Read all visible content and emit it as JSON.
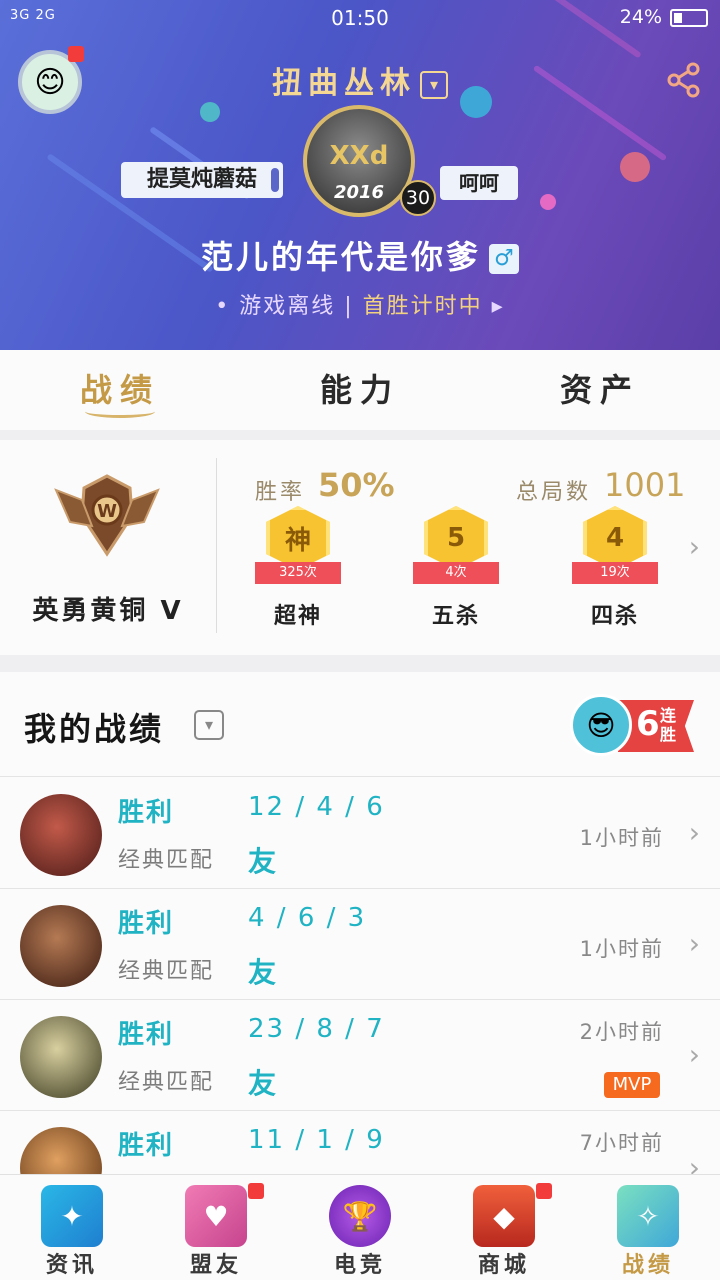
{
  "status_bar": {
    "signal": "3G 2G",
    "time": "01:50",
    "battery": "24%"
  },
  "header": {
    "server": "扭曲丛林",
    "left_tag": "提莫炖蘑菇",
    "right_tag": "呵呵",
    "avatar_logo": "XXd",
    "avatar_year": "2016",
    "level": "30",
    "nickname": "范儿的年代是你爹",
    "gender": "♂",
    "game_status": "游戏离线",
    "first_win": "首胜计时中"
  },
  "tabs": [
    {
      "label": "战绩",
      "active": true
    },
    {
      "label": "能力",
      "active": false
    },
    {
      "label": "资产",
      "active": false
    }
  ],
  "summary": {
    "rank": "英勇黄铜 V",
    "winrate_label": "胜率",
    "winrate": "50%",
    "total_label": "总局数",
    "total": "1001",
    "medals": [
      {
        "glyph": "神",
        "count": "325次",
        "label": "超神"
      },
      {
        "glyph": "5",
        "count": "4次",
        "label": "五杀"
      },
      {
        "glyph": "4",
        "count": "19次",
        "label": "四杀"
      }
    ]
  },
  "records": {
    "title": "我的战绩",
    "streak_number": "6",
    "streak_text": "连胜",
    "items": [
      {
        "result": "胜利",
        "kda": "12 / 4 / 6",
        "mode": "经典匹配",
        "tag": "友",
        "time": "1小时前",
        "mvp": "",
        "color": "#8a2b2b"
      },
      {
        "result": "胜利",
        "kda": "4 / 6 / 3",
        "mode": "经典匹配",
        "tag": "友",
        "time": "1小时前",
        "mvp": "",
        "color": "#7a4a32"
      },
      {
        "result": "胜利",
        "kda": "23 / 8 / 7",
        "mode": "经典匹配",
        "tag": "友",
        "time": "2小时前",
        "mvp": "MVP",
        "color": "#4f5a2c"
      },
      {
        "result": "胜利",
        "kda": "11 / 1 / 9",
        "mode": "",
        "tag": "",
        "time": "7小时前",
        "mvp": "",
        "color": "#9a6a3a"
      }
    ]
  },
  "bottom_nav": [
    {
      "label": "资讯",
      "icon": "book-icon",
      "color": "#2ab7e6",
      "badge": false,
      "active": false
    },
    {
      "label": "盟友",
      "icon": "heart-chat-icon",
      "color": "#e86aa6",
      "badge": true,
      "active": false
    },
    {
      "label": "电竞",
      "icon": "trophy-icon",
      "color": "#8b3fd1",
      "badge": false,
      "active": false
    },
    {
      "label": "商城",
      "icon": "chest-icon",
      "color": "#e2483c",
      "badge": true,
      "active": false
    },
    {
      "label": "战绩",
      "icon": "crest-icon",
      "color": "#5fcfa0",
      "badge": false,
      "active": true
    }
  ]
}
